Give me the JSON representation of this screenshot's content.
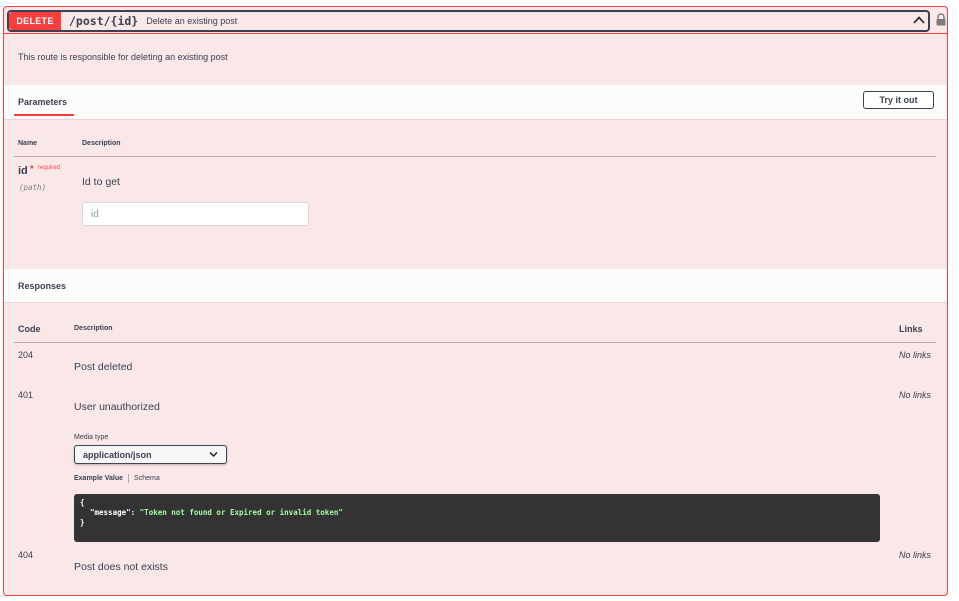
{
  "operation": {
    "method": "DELETE",
    "path": "/post/{id}",
    "summary": "Delete an existing post",
    "description": "This route is responsible for deleting an existing post"
  },
  "parameters": {
    "tab_label": "Parameters",
    "try_button": "Try it out",
    "col_name": "Name",
    "col_description": "Description",
    "items": [
      {
        "name": "id",
        "required_star": "*",
        "required_text": "required",
        "in": "(path)",
        "description": "Id to get",
        "placeholder": "id"
      }
    ]
  },
  "responses": {
    "tab_label": "Responses",
    "col_code": "Code",
    "col_description": "Description",
    "col_links": "Links",
    "items": [
      {
        "code": "204",
        "description": "Post deleted",
        "links": "No links"
      },
      {
        "code": "401",
        "description": "User unauthorized",
        "links": "No links"
      },
      {
        "code": "404",
        "description": "Post does not exists",
        "links": "No links"
      }
    ],
    "media_type_label": "Media type",
    "media_type_value": "application/json",
    "example_tab": "Example Value",
    "schema_tab": "Schema",
    "example": {
      "open": "{",
      "key": "\"message\"",
      "colon": ": ",
      "value": "\"Token not found or Expired or invalid token\"",
      "close": "}"
    }
  },
  "colors": {
    "delete": "#f93e3e",
    "panel_bg": "#fae7e7",
    "text": "#3b4151",
    "code_bg": "#333333"
  },
  "icons": [
    "chevron-up-icon",
    "lock-icon",
    "chevron-down-icon"
  ]
}
